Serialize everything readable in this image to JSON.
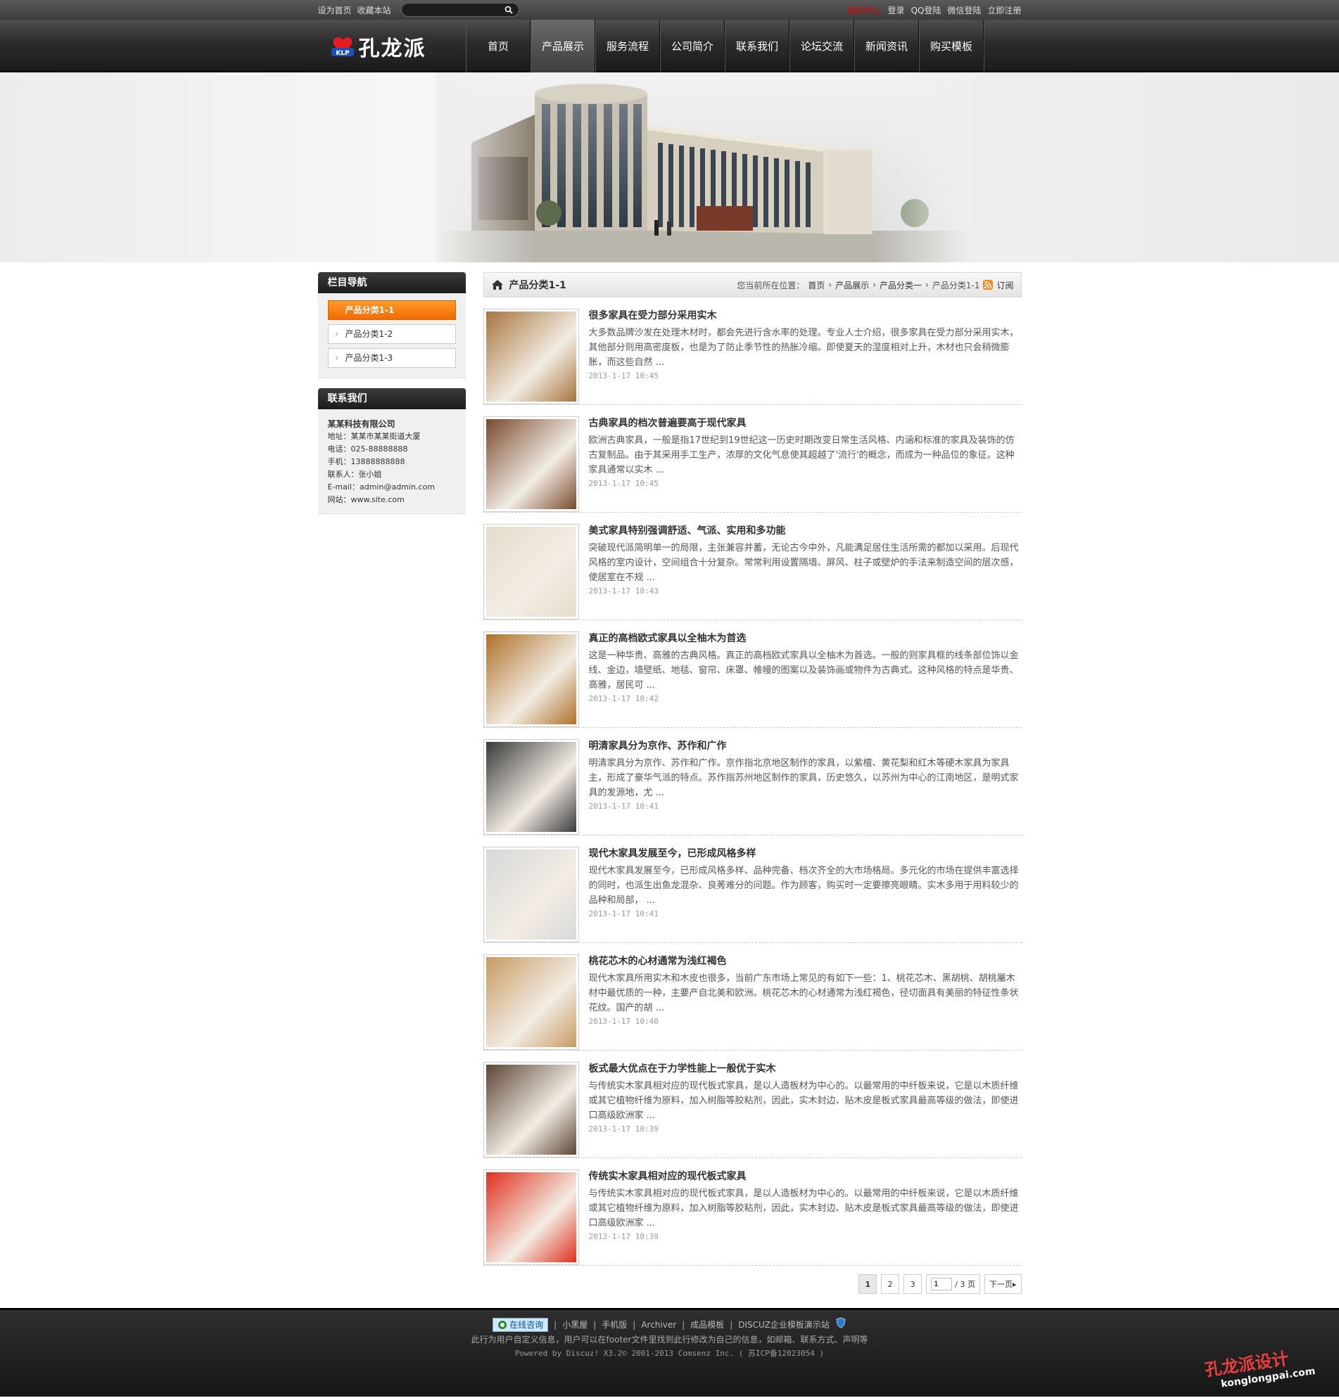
{
  "topbar": {
    "set_home": "设为首页",
    "bookmark": "收藏本站",
    "search_placeholder": "",
    "links": [
      {
        "label": "我的中心",
        "hot": true
      },
      {
        "label": "登录",
        "hot": false
      },
      {
        "label": "QQ登陆",
        "hot": false
      },
      {
        "label": "微信登陆",
        "hot": false
      },
      {
        "label": "立即注册",
        "hot": false
      }
    ]
  },
  "header": {
    "logo_text": "孔龙派",
    "logo_badge": "KLP",
    "nav": [
      {
        "label": "首页",
        "active": false
      },
      {
        "label": "产品展示",
        "active": true
      },
      {
        "label": "服务流程",
        "active": false
      },
      {
        "label": "公司简介",
        "active": false
      },
      {
        "label": "联系我们",
        "active": false
      },
      {
        "label": "论坛交流",
        "active": false
      },
      {
        "label": "新闻资讯",
        "active": false
      },
      {
        "label": "购买模板",
        "active": false
      }
    ]
  },
  "sidebar": {
    "nav_title": "栏目导航",
    "items": [
      {
        "label": "产品分类1-1",
        "active": true
      },
      {
        "label": "产品分类1-2",
        "active": false
      },
      {
        "label": "产品分类1-3",
        "active": false
      }
    ],
    "contact_title": "联系我们",
    "contact": {
      "company": "某某科技有限公司",
      "lines": [
        "地址：某某市某某街道大厦",
        "电话：025-88888888",
        "手机：13888888888",
        "联系人：张小姐",
        "E-mail：admin@admin.com",
        "网站：www.site.com"
      ]
    }
  },
  "crumb": {
    "title": "产品分类1-1",
    "prefix": "您当前所在位置：",
    "path": [
      "首页",
      "产品展示",
      "产品分类一",
      "产品分类1-1"
    ],
    "subscribe": "订阅"
  },
  "articles": [
    {
      "title": "很多家具在受力部分采用实木",
      "summary": "大多数品牌沙发在处理木材时，都会先进行含水率的处理。专业人士介绍，很多家具在受力部分采用实木，其他部分则用高密度板，也是为了防止季节性的热胀冷缩。即使夏天的湿度相对上升，木材也只会稍微膨胀，而这些自然 ...",
      "date": "2013-1-17 10:45",
      "thumb_color": "#a8743e"
    },
    {
      "title": "古典家具的档次普遍要高于现代家具",
      "summary": "欧洲古典家具，一般是指17世纪到19世纪这一历史时期改变日常生活风格、内涵和标准的家具及装饰的仿古复制品。由于其采用手工生产，浓厚的文化气息使其超越了'流行'的概念，而成为一种品位的象征。这种家具通常以实木 ...",
      "date": "2013-1-17 10:45",
      "thumb_color": "#7a4a2e"
    },
    {
      "title": "美式家具特别强调舒适、气派、实用和多功能",
      "summary": "突破现代派简明单一的局限，主张兼容并蓄，无论古今中外，凡能满足居住生活所需的都加以采用。后现代风格的室内设计，空间组合十分复杂。常常利用设置隔墙、屏风、柱子或壁炉的手法来制造空间的层次感，使居室在不规 ...",
      "date": "2013-1-17 10:43",
      "thumb_color": "#e6dccb"
    },
    {
      "title": "真正的高档欧式家具以全柚木为首选",
      "summary": "这是一种华贵、高雅的古典风格。真正的高档欧式家具以全柚木为首选。一般的则家具框的线条部位饰以金线、金边，墙壁纸、地毯、窗帘、床罩、帷幔的图案以及装饰画或物件为古典式。这种风格的特点是华贵、高雅，居民可 ...",
      "date": "2013-1-17 10:42",
      "thumb_color": "#b0702a"
    },
    {
      "title": "明清家具分为京作、苏作和广作",
      "summary": "明清家具分为京作、苏作和广作。京作指北京地区制作的家具，以紫檀、黄花梨和红木等硬木家具为家具主，形成了豪华气派的特点。苏作指苏州地区制作的家具，历史悠久，以苏州为中心的江南地区，是明式家具的发源地，尤 ...",
      "date": "2013-1-17 10:41",
      "thumb_color": "#3a3a3a"
    },
    {
      "title": "现代木家具发展至今，已形成风格多样",
      "summary": "现代木家具发展至今，已形成风格多样、品种完备、档次齐全的大市场格局。多元化的市场在提供丰富选择的同时，也派生出鱼龙混杂、良莠难分的问题。作为顾客，购买时一定要擦亮眼睛。实木多用于用料较少的品种和局部， ...",
      "date": "2013-1-17 10:41",
      "thumb_color": "#d8d8d8"
    },
    {
      "title": "桃花芯木的心材通常为浅红褐色",
      "summary": "现代木家具所用实木和木皮也很多，当前广东市场上常见的有如下一些：1、桃花芯木、黑胡桃、胡桃屬木材中最优质的一种，主要产自北美和欧洲。桃花芯木的心材通常为浅红褐色，径切面具有美丽的特征性条状花纹。国产的胡 ...",
      "date": "2013-1-17 10:40",
      "thumb_color": "#c89a62"
    },
    {
      "title": "板式最大优点在于力学性能上一般优于实木",
      "summary": "与传统实木家具相对应的现代板式家具，是以人造板材为中心的。以最常用的中纤板来说，它是以木质纤维或其它植物纤维为原料，加入树脂等胶粘剂，因此，实木封边、贴木皮是板式家具最高等级的做法，即使进口高级欧洲家 ...",
      "date": "2013-1-17 10:39",
      "thumb_color": "#5c4636"
    },
    {
      "title": "传统实木家具相对应的现代板式家具",
      "summary": "与传统实木家具相对应的现代板式家具，是以人造板材为中心的。以最常用的中纤板来说，它是以木质纤维或其它植物纤维为原料，加入树脂等胶粘剂，因此，实木封边、贴木皮是板式家具最高等级的做法，即使进口高级欧洲家 ...",
      "date": "2013-1-17 10:39",
      "thumb_color": "#e0301e"
    }
  ],
  "pager": {
    "pages": [
      "1",
      "2",
      "3"
    ],
    "current": "1",
    "jump_value": "1",
    "total": "/ 3 页",
    "next": "下一页"
  },
  "footer": {
    "consult": "在线咨询",
    "links": [
      "小黑屋",
      "手机版",
      "Archiver",
      "成品模板",
      "DISCUZ企业模板演示站"
    ],
    "note": "此行为用户自定义信息，用户可以在footer文件里找到此行修改为自己的信息，如邮箱、联系方式、声明等",
    "powered": "Powered by Discuz! X3.2© 2001-2013 Comsenz Inc. ( 苏ICP备12023054 )",
    "watermark_cn": "孔龙派设计",
    "watermark_en": "konglongpai.com"
  },
  "colors": {
    "accent": "#f36b00",
    "header": "#2c2c2c",
    "hot_link": "#e30000"
  }
}
